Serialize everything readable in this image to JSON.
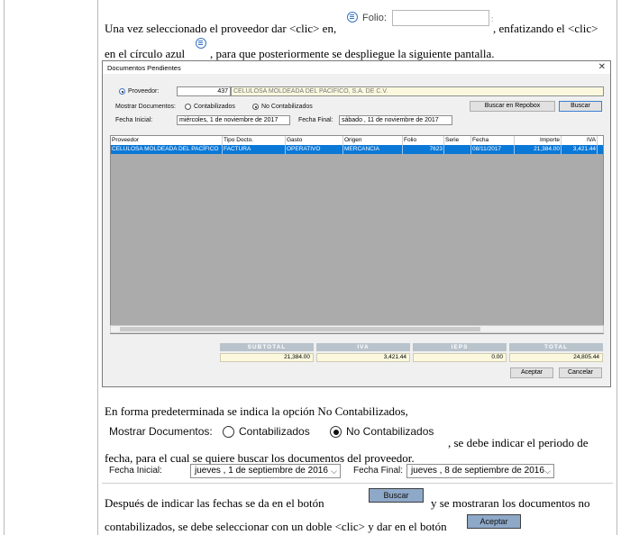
{
  "text": {
    "p1_a": "Una vez seleccionado el proveedor dar <clic> en,",
    "folio_label": "Folio:",
    "p1_colon": ":",
    "p1_b": ", enfatizando el <clic>",
    "p1_c": "en el círculo azul",
    "p1_d": ", para que posteriormente se despliegue la siguiente pantalla.",
    "p2": "En forma predeterminada se indica la opción No Contabilizados,",
    "p3_a": ", se debe indicar el periodo de",
    "p3_b": "fecha, para el cual se quiere buscar los documentos del proveedor.",
    "p4_a": "Después de indicar las fechas se da en el botón",
    "p4_b": "y se mostraran los documentos no",
    "p4_c": "contabilizados, se debe seleccionar con un doble <clic> y dar en el botón"
  },
  "dialog": {
    "title": "Documentos Pendientes",
    "close": "✕",
    "proveedor_label": "Proveedor:",
    "proveedor_id": "437",
    "proveedor_name": "CELULOSA MOLDEADA DEL PACÍFICO, S.A. DE C.V.",
    "mostrar_label": "Mostrar Documentos:",
    "opt_contab": "Contabilizados",
    "opt_nocontab": "No Contabilizados",
    "btn_repobox": "Buscar en Repobox",
    "btn_buscar": "Buscar",
    "fecha_ini_label": "Fecha Inicial:",
    "fecha_ini": "miércoles,   1 de noviembre de 2017",
    "fecha_fin_label": "Fecha Final:",
    "fecha_fin": "sábado  , 11 de noviembre de 2017",
    "columns": [
      "Proveedor",
      "Tipo Docto.",
      "Gasto",
      "Origen",
      "Folio",
      "Serie",
      "Fecha",
      "Importe",
      "IVA"
    ],
    "row": [
      "CELULOSA MOLDEADA DEL PACÍFICO",
      "FACTURA",
      "OPERATIVO",
      "MERCANCIA",
      "7623",
      "",
      "08/11/2017",
      "21,384.00",
      "3,421.44"
    ],
    "totals": [
      {
        "label": "SUBTOTAL",
        "value": "21,384.00"
      },
      {
        "label": "IVA",
        "value": "3,421.44"
      },
      {
        "label": "IEPS",
        "value": "0.00"
      },
      {
        "label": "TOTAL",
        "value": "24,805.44"
      }
    ],
    "btn_aceptar": "Aceptar",
    "btn_cancelar": "Cancelar"
  },
  "widgets": {
    "mostrar_label": "Mostrar Documentos:",
    "opt_contab": "Contabilizados",
    "opt_nocontab": "No Contabilizados",
    "fecha_ini_label": "Fecha Inicial:",
    "fecha_ini": "jueves  ,   1 de septiembre de 2016",
    "fecha_fin_label": "Fecha Final:",
    "fecha_fin": "jueves  ,   8 de septiembre de 2016",
    "btn_buscar": "Buscar",
    "btn_aceptar": "Aceptar",
    "chevron": "⌵"
  },
  "icons": [
    "circle-list-icon",
    "chevron-down-icon",
    "close-icon",
    "radio-icon"
  ],
  "colors": {
    "accent_blue": "#0a78d7",
    "circle_blue": "#3a74c4",
    "button_blue": "#8ea8c8"
  }
}
